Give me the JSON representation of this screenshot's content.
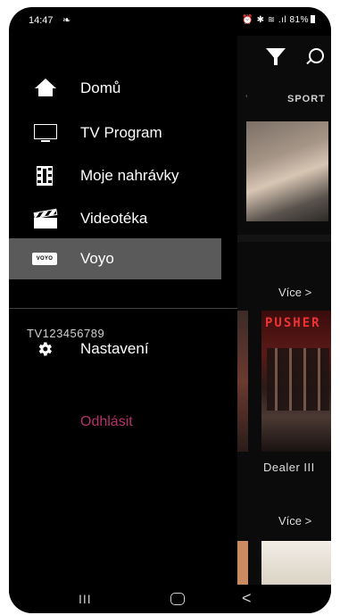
{
  "status": {
    "time": "14:47",
    "right": "81%"
  },
  "background": {
    "tab": "SPORT",
    "more1": "Více >",
    "poster_title": "PUSHER",
    "movie_title": "Dealer III",
    "more2": "Více >"
  },
  "drawer": {
    "items": [
      {
        "label": "Domů",
        "icon": "home-icon"
      },
      {
        "label": "TV Program",
        "icon": "tv-icon"
      },
      {
        "label": "Moje nahrávky",
        "icon": "film-icon"
      },
      {
        "label": "Videotéka",
        "icon": "clapperboard-icon"
      },
      {
        "label": "Voyo",
        "icon": "voyo-logo",
        "logo_text": "VOYO",
        "active": true
      }
    ],
    "account_id": "TV123456789",
    "settings_label": "Nastavení",
    "logout_label": "Odhlásit"
  },
  "colors": {
    "accent": "#b4326a",
    "active_bg": "#5a5a5a"
  },
  "navbar": {
    "recents": "III",
    "back": "<"
  }
}
